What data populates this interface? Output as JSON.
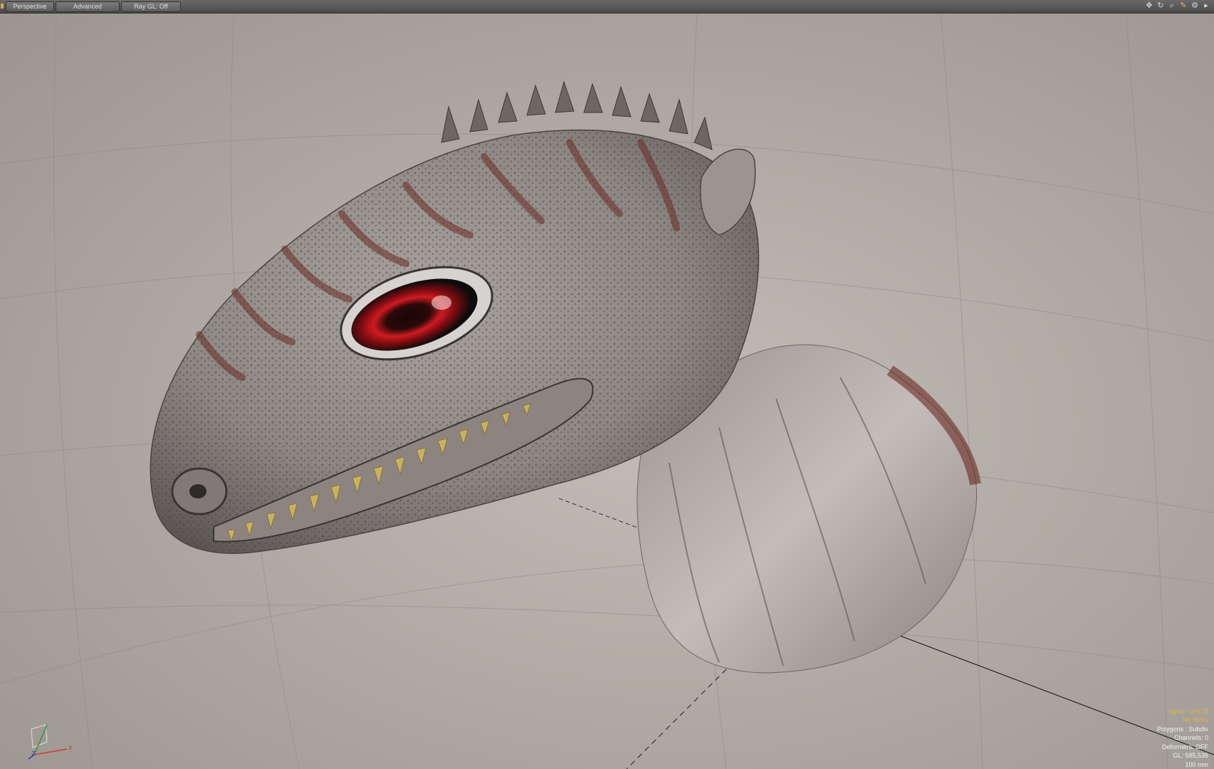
{
  "toolbar": {
    "view_mode": "Perspective",
    "shading_mode": "Advanced",
    "ray_gl": "Ray GL: Off",
    "icons": [
      "move-view-icon",
      "rotate-view-icon",
      "zoom-view-icon",
      "render-icon",
      "settings-icon",
      "expand-icon"
    ]
  },
  "info": {
    "lights": "lights : LHT08",
    "items": "No Items",
    "polygons": "Polygons : Subdiv",
    "channels": "Channels: 0",
    "deformers": "Deformers: OFF",
    "gl": "GL: 585,536",
    "scale": "100 mm"
  },
  "axis": {
    "x": "X",
    "z": "Z"
  },
  "colors": {
    "toolbar": "#555555",
    "highlight": "#e8b24a",
    "eye": "#c8161c",
    "skin": "#8f8a85",
    "stripe": "#6b2a22",
    "teeth": "#c9b35a"
  }
}
